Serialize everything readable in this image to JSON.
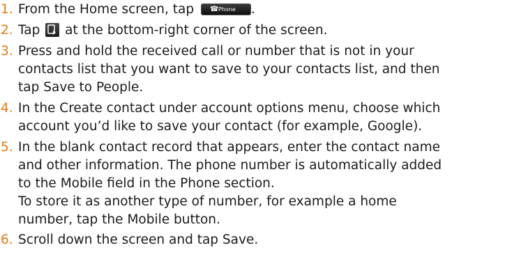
{
  "steps": [
    {
      "number": "1.",
      "text_before": "From the Home screen, tap",
      "icon": "phone-button-icon",
      "icon_label": "Phone",
      "text_after": "."
    },
    {
      "number": "2.",
      "text_before": "Tap",
      "icon": "call-history-icon",
      "text_after": "at the bottom-right corner of the screen."
    },
    {
      "number": "3.",
      "line1": "Press and hold the received call or number that is not in your",
      "line2": "contacts list that you want to save to your contacts list, and then",
      "line3_before": "tap",
      "line3_bold": "Save to People",
      "line3_after": "."
    },
    {
      "number": "4.",
      "line1": "In the Create contact under account options menu, choose which",
      "line2": "account you’d like to save your contact (for example, Google)."
    },
    {
      "number": "5.",
      "line1": "In the blank contact record that appears, enter the contact name",
      "line2": "and other information. The phone number is automatically added",
      "line3_before": "to the",
      "line3_bold": "Mobile",
      "line3_after": "field in the Phone section.",
      "line4": "To store it as another type of number, for example a home",
      "line5_before": "number, tap the",
      "line5_bold": "Mobile",
      "line5_after": "button."
    },
    {
      "number": "6.",
      "text_before": "Scroll down the screen and tap",
      "bold": "Save",
      "text_after": "."
    }
  ],
  "colors": {
    "step_number": "#e07a10",
    "text": "#1a1a1a"
  }
}
